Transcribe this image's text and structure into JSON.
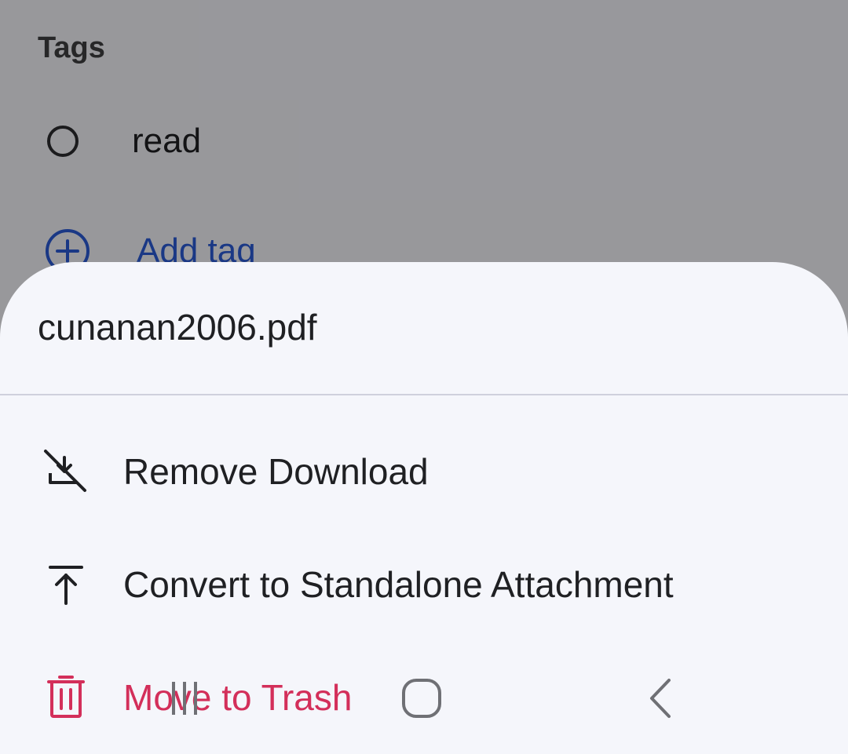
{
  "background": {
    "section_title": "Tags",
    "tags": [
      {
        "label": "read"
      }
    ],
    "add_tag_label": "Add tag"
  },
  "sheet": {
    "title": "cunanan2006.pdf",
    "items": [
      {
        "label": "Remove Download",
        "icon": "download-off-icon"
      },
      {
        "label": "Convert to Standalone Attachment",
        "icon": "upload-to-top-icon"
      },
      {
        "label": "Move to Trash",
        "icon": "trash-icon",
        "color": "#d32f5a"
      }
    ]
  },
  "nav_bar": {
    "recents_icon": "recents-icon",
    "home_icon": "home-icon",
    "back_icon": "back-icon"
  },
  "colors": {
    "accent": "#2a5bd7",
    "danger": "#d32f5a",
    "sheet_bg": "#f5f6fb",
    "divider": "#cfd0dc"
  }
}
